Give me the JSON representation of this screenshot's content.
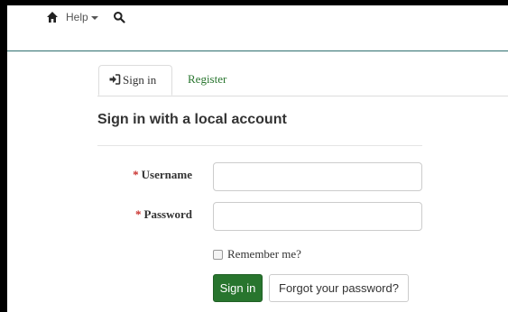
{
  "navbar": {
    "home_icon": "home-icon",
    "help_label": "Help",
    "search_icon": "search-icon"
  },
  "tabs": {
    "signin_label": "Sign in",
    "signin_icon": "sign-in-icon",
    "register_label": "Register"
  },
  "form": {
    "heading": "Sign in with a local account",
    "required_marker": "*",
    "username_label": "Username",
    "username_value": "",
    "password_label": "Password",
    "password_value": "",
    "remember_label": "Remember me?",
    "remember_checked": false,
    "signin_button": "Sign in",
    "forgot_button": "Forgot your password?"
  },
  "colors": {
    "brand_green": "#28752e",
    "required_red": "#c9302c",
    "navbar_border": "#2e6f6f"
  }
}
